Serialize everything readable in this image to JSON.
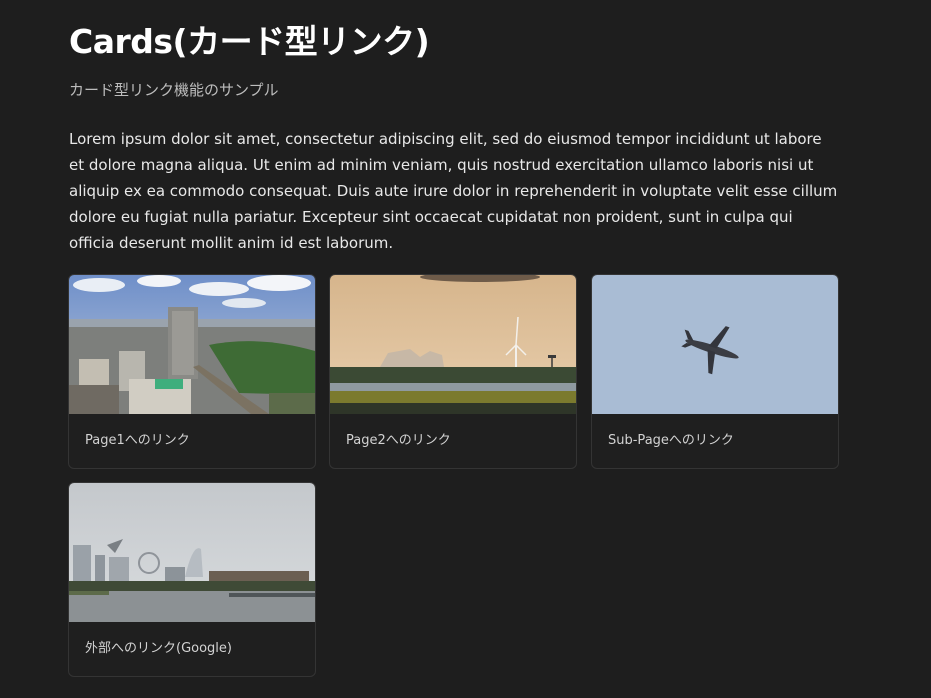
{
  "page": {
    "title": "Cards(カード型リンク)",
    "subtitle": "カード型リンク機能のサンプル",
    "body": "Lorem ipsum dolor sit amet, consectetur adipiscing elit, sed do eiusmod tempor incididunt ut labore et dolore magna aliqua. Ut enim ad minim veniam, quis nostrud exercitation ullamco laboris nisi ut aliquip ex ea commodo consequat. Duis aute irure dolor in reprehenderit in voluptate velit esse cillum dolore eu fugiat nulla pariatur. Excepteur sint occaecat cupidatat non proident, sunt in culpa qui officia deserunt mollit anim id est laborum."
  },
  "cards": [
    {
      "label": "Page1へのリンク",
      "image": "city-skyline-photo"
    },
    {
      "label": "Page2へのリンク",
      "image": "wind-turbine-photo"
    },
    {
      "label": "Sub-Pageへのリンク",
      "image": "airplane-photo"
    },
    {
      "label": "外部へのリンク(Google)",
      "image": "harbor-skyline-photo"
    }
  ]
}
